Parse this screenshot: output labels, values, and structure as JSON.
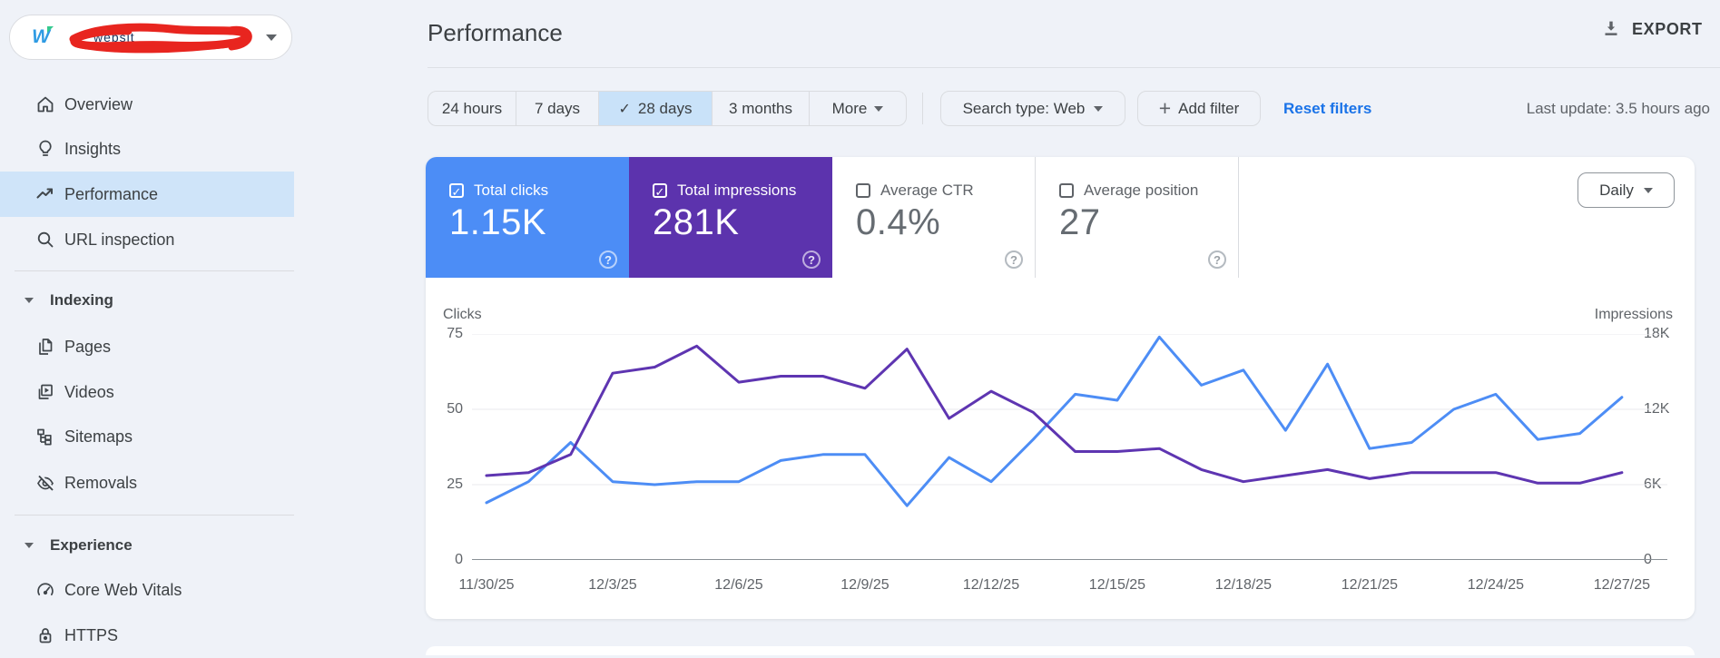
{
  "colors": {
    "link_blue": "#1a73e8",
    "clicks_blue": "#4c8df6",
    "impressions_purple": "#5c33ad",
    "chart_blue_line": "#4d8df5",
    "chart_purple_line": "#5e35b1",
    "selected_nav_bg": "#cfe4f9",
    "selected_chip_bg": "#c9e2f9"
  },
  "sidebar": {
    "site_selector": {
      "logo_letter": "W",
      "visible_fragment": "websit",
      "redaction_scribble": true
    },
    "items": [
      {
        "label": "Overview",
        "icon": "home-icon",
        "selected": false
      },
      {
        "label": "Insights",
        "icon": "lightbulb-icon",
        "selected": false
      },
      {
        "label": "Performance",
        "icon": "trending-up-icon",
        "selected": true
      },
      {
        "label": "URL inspection",
        "icon": "search-icon",
        "selected": false
      }
    ],
    "sections": [
      {
        "header": "Indexing",
        "items": [
          {
            "label": "Pages",
            "icon": "pages-icon"
          },
          {
            "label": "Videos",
            "icon": "video-icon"
          },
          {
            "label": "Sitemaps",
            "icon": "sitemap-icon"
          },
          {
            "label": "Removals",
            "icon": "eye-off-icon"
          }
        ]
      },
      {
        "header": "Experience",
        "items": [
          {
            "label": "Core Web Vitals",
            "icon": "gauge-icon"
          },
          {
            "label": "HTTPS",
            "icon": "lock-icon"
          }
        ]
      }
    ]
  },
  "header": {
    "title": "Performance",
    "export_label": "EXPORT"
  },
  "filters": {
    "date_ranges": [
      {
        "label": "24 hours",
        "selected": false
      },
      {
        "label": "7 days",
        "selected": false
      },
      {
        "label": "28 days",
        "selected": true
      },
      {
        "label": "3 months",
        "selected": false
      }
    ],
    "more_label": "More",
    "search_type": "Search type: Web",
    "add_filter": "Add filter",
    "reset_filters": "Reset filters",
    "last_update": "Last update: 3.5 hours ago"
  },
  "metrics": [
    {
      "label": "Total clicks",
      "value": "1.15K",
      "checked": true,
      "bg": "#4c8df6"
    },
    {
      "label": "Total impressions",
      "value": "281K",
      "checked": true,
      "bg": "#5c33ad"
    },
    {
      "label": "Average CTR",
      "value": "0.4%",
      "checked": false,
      "bg": "#ffffff"
    },
    {
      "label": "Average position",
      "value": "27",
      "checked": false,
      "bg": "#ffffff"
    }
  ],
  "granularity": {
    "label": "Daily"
  },
  "chart_data": {
    "type": "line",
    "title": "Clicks and impressions, daily, 28 days",
    "x": [
      "11/30/25",
      "12/1/25",
      "12/2/25",
      "12/3/25",
      "12/4/25",
      "12/5/25",
      "12/6/25",
      "12/7/25",
      "12/8/25",
      "12/9/25",
      "12/10/25",
      "12/11/25",
      "12/12/25",
      "12/13/25",
      "12/14/25",
      "12/15/25",
      "12/16/25",
      "12/17/25",
      "12/18/25",
      "12/19/25",
      "12/20/25",
      "12/21/25",
      "12/22/25",
      "12/23/25",
      "12/24/25",
      "12/25/25",
      "12/26/25",
      "12/27/25"
    ],
    "x_tick_labels": [
      "11/30/25",
      "12/3/25",
      "12/6/25",
      "12/9/25",
      "12/12/25",
      "12/15/25",
      "12/18/25",
      "12/21/25",
      "12/24/25",
      "12/27/25"
    ],
    "series": [
      {
        "name": "Clicks",
        "axis": "left",
        "color": "#4d8df5",
        "values": [
          19,
          26,
          39,
          26,
          25,
          26,
          26,
          33,
          35,
          35,
          18,
          34,
          26,
          40,
          55,
          53,
          74,
          58,
          63,
          43,
          65,
          37,
          39,
          50,
          55,
          40,
          42,
          54
        ]
      },
      {
        "name": "Impressions",
        "axis": "right",
        "color": "#5e35b1",
        "values": [
          6720,
          6960,
          8400,
          14880,
          15360,
          17040,
          14160,
          14640,
          14640,
          13680,
          16800,
          11280,
          13440,
          11760,
          8640,
          8640,
          8880,
          7200,
          6240,
          6720,
          7200,
          6480,
          6960,
          6960,
          6960,
          6120,
          6120,
          6960
        ]
      }
    ],
    "y_left": {
      "label": "Clicks",
      "ticks": [
        0,
        25,
        50,
        75
      ],
      "max": 75
    },
    "y_right": {
      "label": "Impressions",
      "ticks": [
        "0",
        "6K",
        "12K",
        "18K"
      ],
      "max": 18000
    },
    "grid": true,
    "legend": "none"
  }
}
